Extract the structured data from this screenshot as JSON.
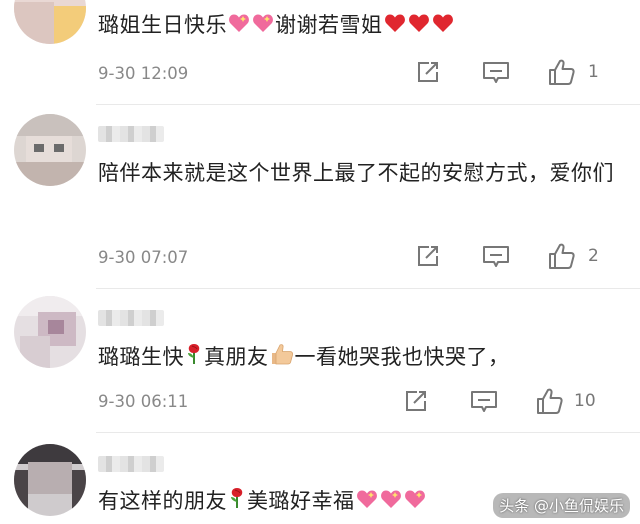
{
  "comments": [
    {
      "text_a": "璐姐生日快乐",
      "text_b": "谢谢若雪姐",
      "timestamp": "9-30 12:09",
      "likes": "1"
    },
    {
      "text": "陪伴本来就是这个世界上最了不起的安慰方式，爱你们",
      "timestamp": "9-30 07:07",
      "likes": "2"
    },
    {
      "text_a": "璐璐生快",
      "text_b": "真朋友",
      "text_c": "一看她哭我也快哭了，",
      "timestamp": "9-30 06:11",
      "likes": "10"
    },
    {
      "text_a": "有这样的朋友",
      "text_b": "美璐好幸福"
    }
  ],
  "watermark": "头条 @小鱼侃娱乐",
  "colors": {
    "text": "#222222",
    "meta": "#888888",
    "heart": "#e0272f",
    "love_heart": "#f06a9c"
  },
  "icons": [
    "share-icon",
    "comment-icon",
    "like-icon",
    "rose-icon",
    "thumbs-up-icon",
    "sparkling-heart-icon",
    "red-heart-icon"
  ]
}
